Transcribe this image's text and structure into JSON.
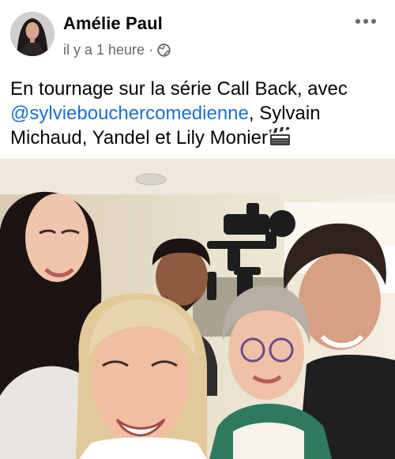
{
  "post": {
    "author": "Amélie Paul",
    "timestamp": "il y a 1 heure",
    "separator": "·",
    "privacy_icon": "globe-icon",
    "more_icon": "more-horizontal-icon",
    "text_before_mention": "En tournage sur la série Call Back, avec",
    "mention": "@sylviebouchercomedienne",
    "text_after_mention_line1": ", Sylvain",
    "text_line3": "Michaud, Yandel et Lily Monier",
    "emoji_icon": "clapper-board-icon"
  },
  "colors": {
    "name": "#050505",
    "meta": "#65676b",
    "mention": "#1d6fd2",
    "background": "#ffffff"
  }
}
